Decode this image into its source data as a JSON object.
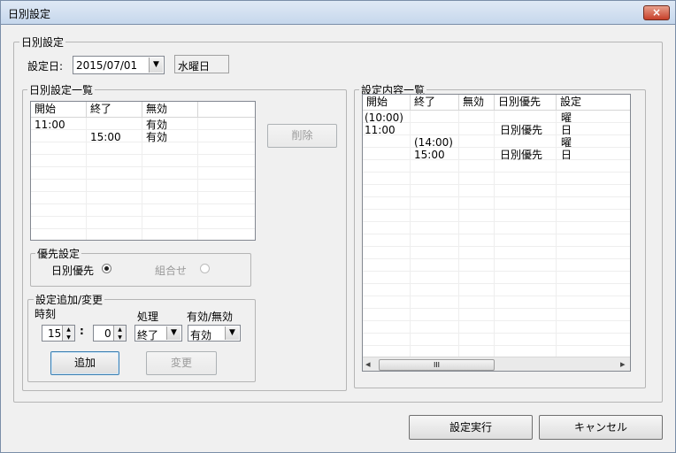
{
  "window": {
    "title": "日別設定",
    "close_label": "×"
  },
  "main_group": {
    "label": "日別設定"
  },
  "date": {
    "label": "設定日:",
    "value": "2015/07/01",
    "weekday": "水曜日"
  },
  "list_group": {
    "label": "日別設定一覧",
    "columns": [
      "開始",
      "終了",
      "無効"
    ],
    "rows": [
      [
        "11:00",
        "",
        "有効"
      ],
      [
        "",
        "15:00",
        "有効"
      ]
    ]
  },
  "delete_button": "削除",
  "priority": {
    "label": "優先設定",
    "option1": "日別優先",
    "option2": "組合せ"
  },
  "add_change": {
    "label": "設定追加/変更",
    "time_label": "時刻",
    "hour": "15",
    "colon": ":",
    "minute": "0",
    "process_label": "処理",
    "process_value": "終了",
    "valid_label": "有効/無効",
    "valid_value": "有効",
    "add_button": "追加",
    "change_button": "変更"
  },
  "content_group": {
    "label": "設定内容一覧",
    "columns": [
      "開始",
      "終了",
      "無効",
      "日別優先",
      "設定"
    ],
    "rows": [
      [
        "(10:00)",
        "",
        "",
        "",
        "曜"
      ],
      [
        "11:00",
        "",
        "",
        "日別優先",
        "日"
      ],
      [
        "",
        "(14:00)",
        "",
        "",
        "曜"
      ],
      [
        "",
        "15:00",
        "",
        "日別優先",
        "日"
      ]
    ],
    "scroll_left": "◂",
    "scroll_right": "▸",
    "scroll_grip": "III"
  },
  "footer": {
    "execute_button": "設定実行",
    "cancel_button": "キャンセル"
  }
}
